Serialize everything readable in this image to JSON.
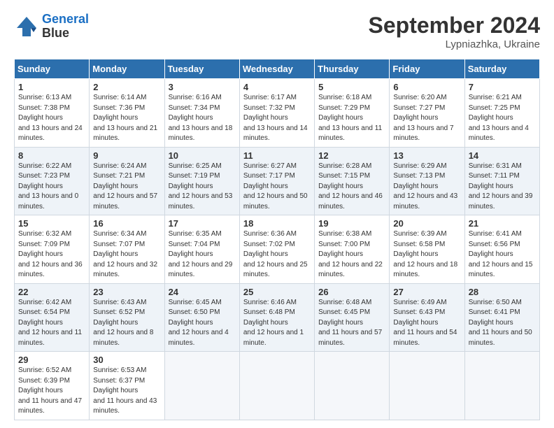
{
  "header": {
    "logo_line1": "General",
    "logo_line2": "Blue",
    "month": "September 2024",
    "location": "Lypniazhka, Ukraine"
  },
  "days_of_week": [
    "Sunday",
    "Monday",
    "Tuesday",
    "Wednesday",
    "Thursday",
    "Friday",
    "Saturday"
  ],
  "weeks": [
    [
      {
        "num": "1",
        "sunrise": "6:13 AM",
        "sunset": "7:38 PM",
        "daylight": "13 hours and 24 minutes."
      },
      {
        "num": "2",
        "sunrise": "6:14 AM",
        "sunset": "7:36 PM",
        "daylight": "13 hours and 21 minutes."
      },
      {
        "num": "3",
        "sunrise": "6:16 AM",
        "sunset": "7:34 PM",
        "daylight": "13 hours and 18 minutes."
      },
      {
        "num": "4",
        "sunrise": "6:17 AM",
        "sunset": "7:32 PM",
        "daylight": "13 hours and 14 minutes."
      },
      {
        "num": "5",
        "sunrise": "6:18 AM",
        "sunset": "7:29 PM",
        "daylight": "13 hours and 11 minutes."
      },
      {
        "num": "6",
        "sunrise": "6:20 AM",
        "sunset": "7:27 PM",
        "daylight": "13 hours and 7 minutes."
      },
      {
        "num": "7",
        "sunrise": "6:21 AM",
        "sunset": "7:25 PM",
        "daylight": "13 hours and 4 minutes."
      }
    ],
    [
      {
        "num": "8",
        "sunrise": "6:22 AM",
        "sunset": "7:23 PM",
        "daylight": "13 hours and 0 minutes."
      },
      {
        "num": "9",
        "sunrise": "6:24 AM",
        "sunset": "7:21 PM",
        "daylight": "12 hours and 57 minutes."
      },
      {
        "num": "10",
        "sunrise": "6:25 AM",
        "sunset": "7:19 PM",
        "daylight": "12 hours and 53 minutes."
      },
      {
        "num": "11",
        "sunrise": "6:27 AM",
        "sunset": "7:17 PM",
        "daylight": "12 hours and 50 minutes."
      },
      {
        "num": "12",
        "sunrise": "6:28 AM",
        "sunset": "7:15 PM",
        "daylight": "12 hours and 46 minutes."
      },
      {
        "num": "13",
        "sunrise": "6:29 AM",
        "sunset": "7:13 PM",
        "daylight": "12 hours and 43 minutes."
      },
      {
        "num": "14",
        "sunrise": "6:31 AM",
        "sunset": "7:11 PM",
        "daylight": "12 hours and 39 minutes."
      }
    ],
    [
      {
        "num": "15",
        "sunrise": "6:32 AM",
        "sunset": "7:09 PM",
        "daylight": "12 hours and 36 minutes."
      },
      {
        "num": "16",
        "sunrise": "6:34 AM",
        "sunset": "7:07 PM",
        "daylight": "12 hours and 32 minutes."
      },
      {
        "num": "17",
        "sunrise": "6:35 AM",
        "sunset": "7:04 PM",
        "daylight": "12 hours and 29 minutes."
      },
      {
        "num": "18",
        "sunrise": "6:36 AM",
        "sunset": "7:02 PM",
        "daylight": "12 hours and 25 minutes."
      },
      {
        "num": "19",
        "sunrise": "6:38 AM",
        "sunset": "7:00 PM",
        "daylight": "12 hours and 22 minutes."
      },
      {
        "num": "20",
        "sunrise": "6:39 AM",
        "sunset": "6:58 PM",
        "daylight": "12 hours and 18 minutes."
      },
      {
        "num": "21",
        "sunrise": "6:41 AM",
        "sunset": "6:56 PM",
        "daylight": "12 hours and 15 minutes."
      }
    ],
    [
      {
        "num": "22",
        "sunrise": "6:42 AM",
        "sunset": "6:54 PM",
        "daylight": "12 hours and 11 minutes."
      },
      {
        "num": "23",
        "sunrise": "6:43 AM",
        "sunset": "6:52 PM",
        "daylight": "12 hours and 8 minutes."
      },
      {
        "num": "24",
        "sunrise": "6:45 AM",
        "sunset": "6:50 PM",
        "daylight": "12 hours and 4 minutes."
      },
      {
        "num": "25",
        "sunrise": "6:46 AM",
        "sunset": "6:48 PM",
        "daylight": "12 hours and 1 minute."
      },
      {
        "num": "26",
        "sunrise": "6:48 AM",
        "sunset": "6:45 PM",
        "daylight": "11 hours and 57 minutes."
      },
      {
        "num": "27",
        "sunrise": "6:49 AM",
        "sunset": "6:43 PM",
        "daylight": "11 hours and 54 minutes."
      },
      {
        "num": "28",
        "sunrise": "6:50 AM",
        "sunset": "6:41 PM",
        "daylight": "11 hours and 50 minutes."
      }
    ],
    [
      {
        "num": "29",
        "sunrise": "6:52 AM",
        "sunset": "6:39 PM",
        "daylight": "11 hours and 47 minutes."
      },
      {
        "num": "30",
        "sunrise": "6:53 AM",
        "sunset": "6:37 PM",
        "daylight": "11 hours and 43 minutes."
      },
      null,
      null,
      null,
      null,
      null
    ]
  ]
}
